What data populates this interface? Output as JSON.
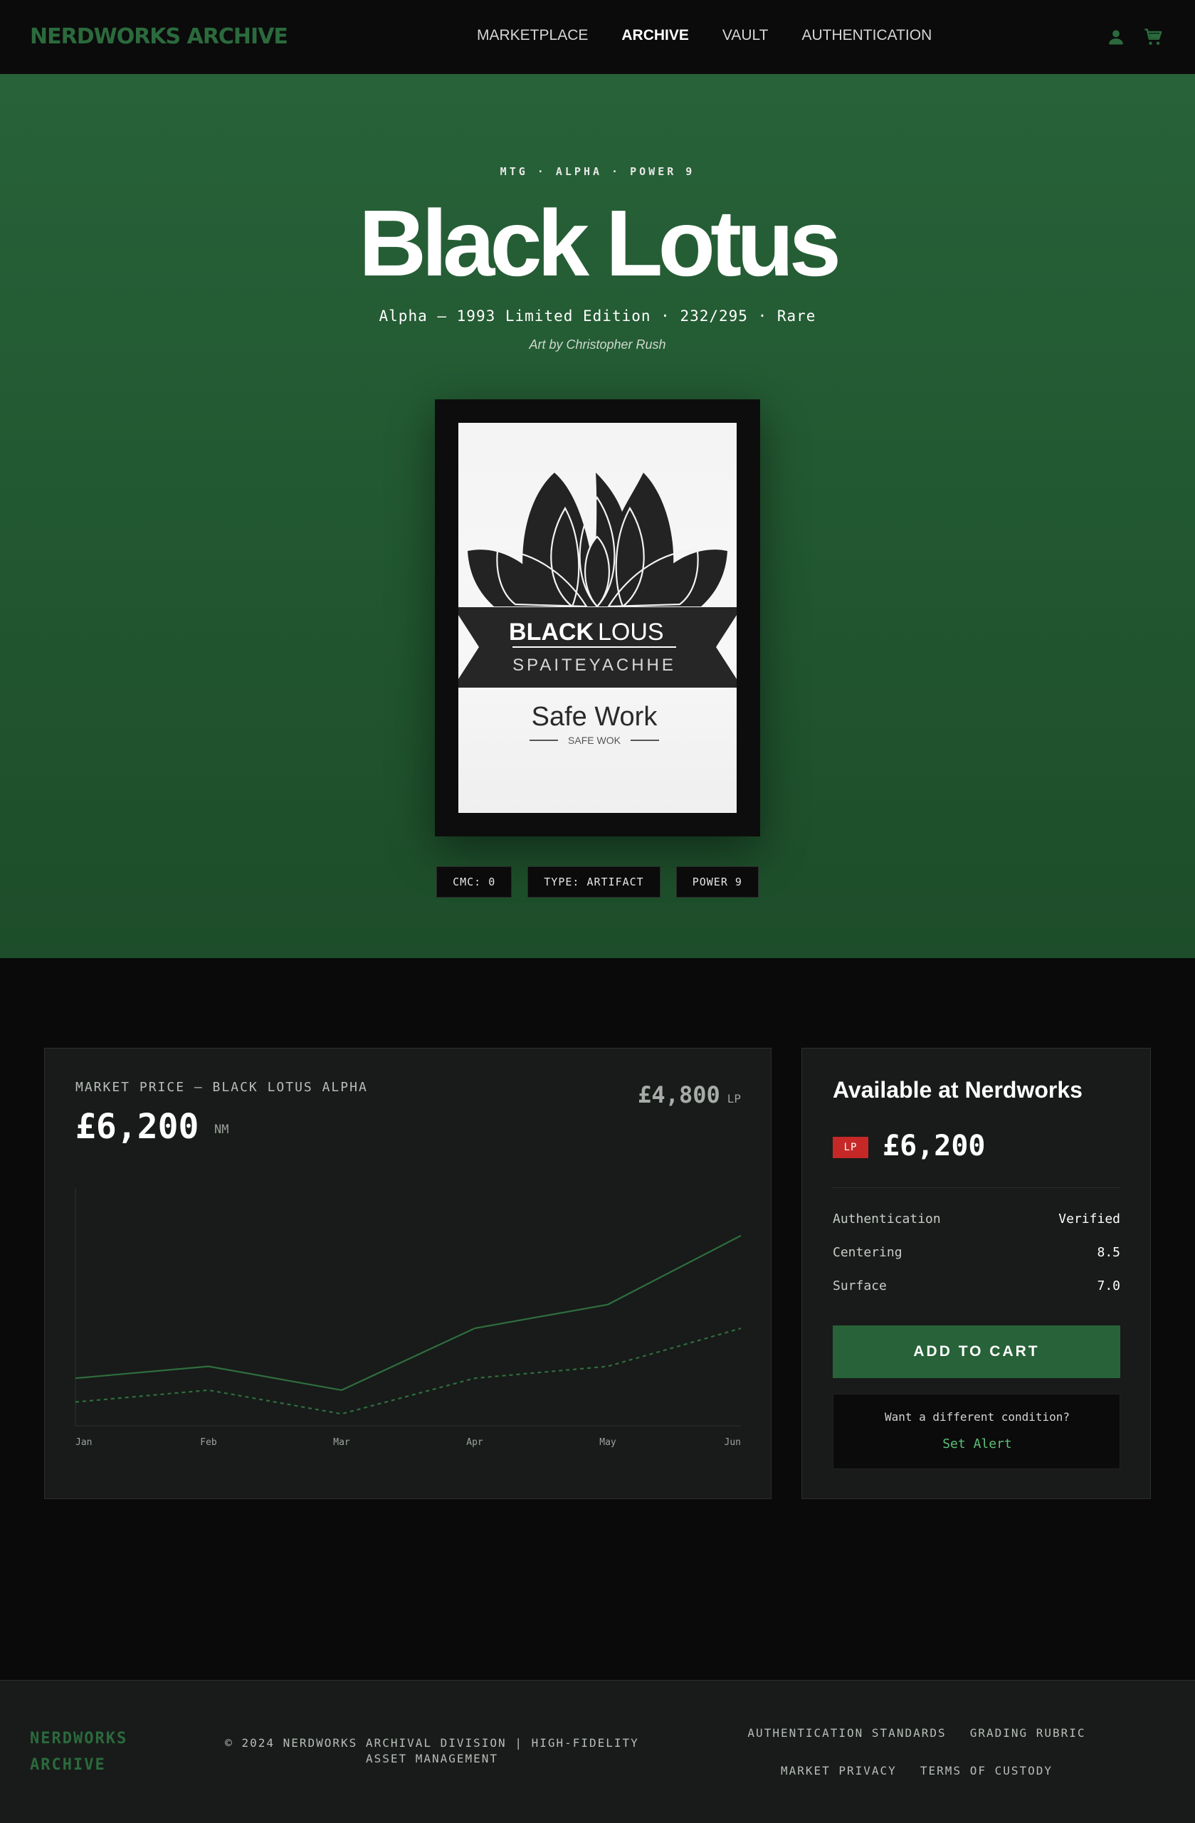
{
  "nav": {
    "brand": "NERDWORKS ARCHIVE",
    "links": [
      "MARKETPLACE",
      "ARCHIVE",
      "VAULT",
      "AUTHENTICATION"
    ],
    "active": "ARCHIVE",
    "icons": [
      "account-icon",
      "cart-icon"
    ]
  },
  "hero": {
    "eyebrow": "MTG · ALPHA · POWER 9",
    "title": "Black Lotus",
    "subtitle": "Alpha — 1993 Limited Edition · 232/295 · Rare",
    "artist": "Art by Christopher Rush",
    "card_art": {
      "line1_bold": "BLACK",
      "line1_light": "LOUS",
      "line2": "SPAITEYACHHE",
      "line3": "Safe Work",
      "line4": "SAFE WOK"
    },
    "tags": [
      "CMC: 0",
      "TYPE: ARTIFACT",
      "POWER 9"
    ]
  },
  "market": {
    "label": "MARKET PRICE — BLACK LOTUS ALPHA",
    "price": "£6,200",
    "price_unit": "NM",
    "alt_price": "£4,800",
    "alt_unit": "LP"
  },
  "chart_data": {
    "type": "line",
    "title": "",
    "x": [
      "Jan",
      "Feb",
      "Mar",
      "Apr",
      "May",
      "Jun"
    ],
    "series": [
      {
        "values": [
          0.2,
          0.25,
          0.15,
          0.41,
          0.51,
          0.8
        ]
      },
      {
        "values": [
          0.1,
          0.15,
          0.05,
          0.2,
          0.25,
          0.41
        ]
      }
    ],
    "ylim": [
      0,
      1
    ],
    "grid": false,
    "colors": [
      "#2f6e3f",
      "#2f6e3f"
    ],
    "styles": [
      "solid",
      "dashed"
    ]
  },
  "availability": {
    "title": "Available at Nerdworks",
    "condition": "LP",
    "condition_color": "#c62828",
    "price": "£6,200",
    "specs": [
      {
        "label": "Authentication",
        "value": "Verified"
      },
      {
        "label": "Centering",
        "value": "8.5"
      },
      {
        "label": "Surface",
        "value": "7.0"
      }
    ],
    "cart_label": "ADD TO CART",
    "alert_question": "Want a different condition?",
    "alert_link": "Set Alert"
  },
  "footer": {
    "brand_line1": "NERDWORKS",
    "brand_line2": "ARCHIVE",
    "copyright": "© 2024 NERDWORKS ARCHIVAL DIVISION | HIGH-FIDELITY ASSET MANAGEMENT",
    "links": [
      "AUTHENTICATION STANDARDS",
      "GRADING RUBRIC",
      "MARKET PRIVACY",
      "TERMS OF CUSTODY"
    ]
  },
  "colors": {
    "accent": "#276238",
    "brand": "#2b6a3d",
    "link": "#5fbf7a"
  }
}
